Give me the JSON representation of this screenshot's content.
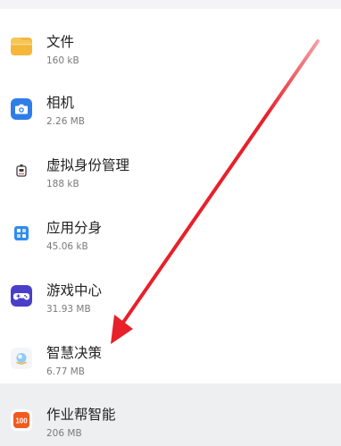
{
  "apps": [
    {
      "name": "文件",
      "size": "160 kB",
      "icon": "folder-icon",
      "icon_color": "#f5b73a"
    },
    {
      "name": "相机",
      "size": "2.26 MB",
      "icon": "camera-icon",
      "icon_color": "#2f7de8"
    },
    {
      "name": "虚拟身份管理",
      "size": "188 kB",
      "icon": "virtual-id-icon",
      "icon_color": "#e8e8e8"
    },
    {
      "name": "应用分身",
      "size": "45.06 kB",
      "icon": "app-twin-icon",
      "icon_color": "#2f8cf0"
    },
    {
      "name": "游戏中心",
      "size": "31.93 MB",
      "icon": "gamepad-icon",
      "icon_color": "#4a3fc9"
    },
    {
      "name": "智慧决策",
      "size": "6.77 MB",
      "icon": "smart-decision-icon",
      "icon_color": "#f3f5f8"
    },
    {
      "name": "作业帮智能",
      "size": "206 MB",
      "icon": "zuoyebang-icon",
      "icon_color": "#f25a1f"
    }
  ],
  "annotation": {
    "arrow_color": "#e8202a",
    "arrow_points_to": "智慧决策"
  }
}
